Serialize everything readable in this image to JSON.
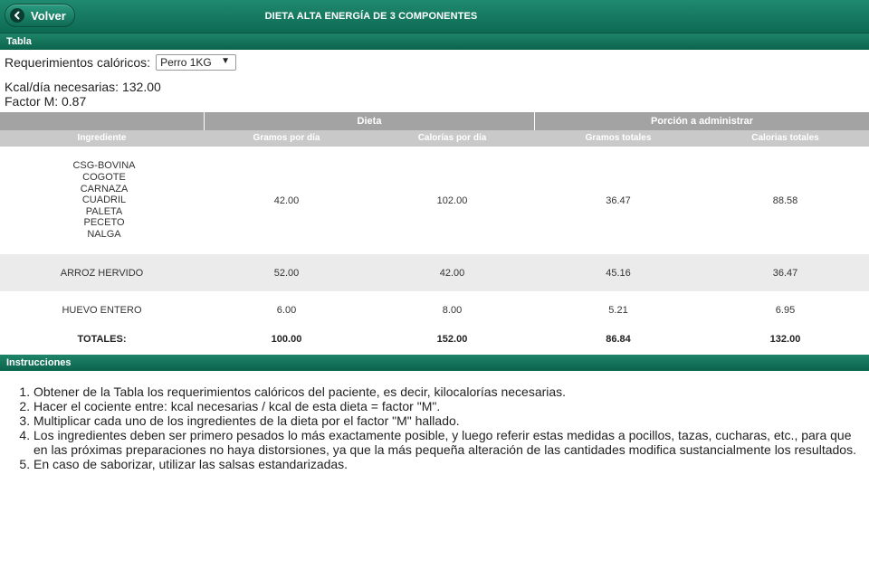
{
  "header": {
    "back_label": "Volver",
    "title": "DIETA ALTA ENERGÍA DE 3 COMPONENTES"
  },
  "tabla": {
    "section_label": "Tabla",
    "requirements_label": "Requerimientos calóricos:",
    "select_value": "Perro 1KG",
    "kcal_text": "Kcal/día necesarias: 132.00",
    "factor_text": "Factor M: 0.87"
  },
  "table": {
    "groups": {
      "dieta": "Dieta",
      "porcion": "Porción a administrar"
    },
    "columns": [
      "Ingrediente",
      "Gramos por día",
      "Calorías por día",
      "Gramos totales",
      "Calorias totales"
    ],
    "rows": [
      {
        "ingredient": [
          "CSG-BOVINA",
          "COGOTE",
          "CARNAZA",
          "CUADRIL",
          "PALETA",
          "PECETO",
          "NALGA"
        ],
        "gramos_dia": "42.00",
        "calorias_dia": "102.00",
        "gramos_totales": "36.47",
        "calorias_totales": "88.58"
      },
      {
        "ingredient": [
          "ARROZ HERVIDO"
        ],
        "gramos_dia": "52.00",
        "calorias_dia": "42.00",
        "gramos_totales": "45.16",
        "calorias_totales": "36.47"
      },
      {
        "ingredient": [
          "HUEVO ENTERO"
        ],
        "gramos_dia": "6.00",
        "calorias_dia": "8.00",
        "gramos_totales": "5.21",
        "calorias_totales": "6.95"
      }
    ],
    "totals": {
      "label": "TOTALES:",
      "gramos_dia": "100.00",
      "calorias_dia": "152.00",
      "gramos_totales": "86.84",
      "calorias_totales": "132.00"
    }
  },
  "instrucciones": {
    "section_label": "Instrucciones",
    "items": [
      "Obtener de la Tabla los requerimientos calóricos del paciente, es decir, kilocalorías necesarias.",
      "Hacer el cociente entre: kcal necesarias / kcal de esta dieta = factor \"M\".",
      "Multiplicar cada uno de los ingredientes de la dieta por el factor \"M\" hallado.",
      "Los ingredientes deben ser primero pesados lo más exactamente posible, y luego referir estas medidas a pocillos, tazas, cucharas, etc., para que en las próximas preparaciones no haya distorsiones, ya que la más pequeña alteración de las cantidades modifica sustancialmente los resultados.",
      "En caso de saborizar, utilizar las salsas estandarizadas."
    ]
  },
  "colors": {
    "header_green": "#0d6a53",
    "group_header_gray": "#a3a3a3",
    "column_header_gray": "#c9c9c9",
    "row_alt": "#ebebeb"
  }
}
